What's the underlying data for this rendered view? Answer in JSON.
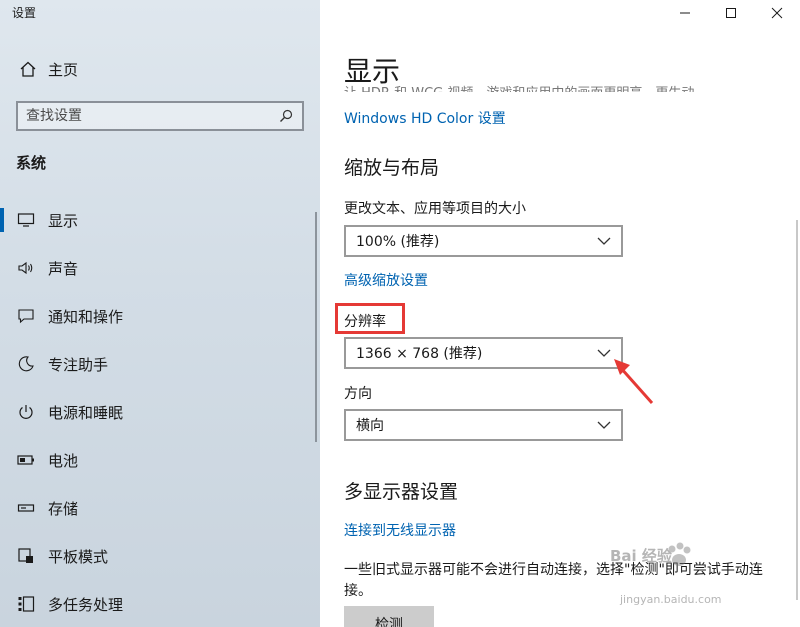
{
  "window": {
    "title": "设置"
  },
  "sidebar": {
    "home_label": "主页",
    "search_placeholder": "查找设置",
    "section_label": "系统",
    "items": [
      {
        "label": "显示",
        "icon": "monitor-icon",
        "active": true
      },
      {
        "label": "声音",
        "icon": "speaker-icon"
      },
      {
        "label": "通知和操作",
        "icon": "message-icon"
      },
      {
        "label": "专注助手",
        "icon": "moon-icon"
      },
      {
        "label": "电源和睡眠",
        "icon": "power-icon"
      },
      {
        "label": "电池",
        "icon": "battery-icon"
      },
      {
        "label": "存储",
        "icon": "storage-icon"
      },
      {
        "label": "平板模式",
        "icon": "tablet-icon"
      },
      {
        "label": "多任务处理",
        "icon": "multitask-icon"
      }
    ]
  },
  "main": {
    "title": "显示",
    "cut_text": "让 HDR 和 WCG 视频、游戏和应用中的画面更明亮、更生动。",
    "hd_color_link": "Windows HD Color 设置",
    "scale_section": {
      "heading": "缩放与布局",
      "scale_label": "更改文本、应用等项目的大小",
      "scale_value": "100% (推荐)",
      "advanced_link": "高级缩放设置",
      "resolution_label": "分辨率",
      "resolution_value": "1366 × 768 (推荐)",
      "orientation_label": "方向",
      "orientation_value": "横向"
    },
    "multi_section": {
      "heading": "多显示器设置",
      "wireless_link": "连接到无线显示器",
      "description": "一些旧式显示器可能不会进行自动连接，选择\"检测\"即可尝试手动连接。",
      "detect_label": "检测"
    }
  },
  "watermark": {
    "text": "Bai 经验",
    "url": "jingyan.baidu.com"
  },
  "colors": {
    "accent": "#0063b1",
    "highlight": "#e53935"
  }
}
